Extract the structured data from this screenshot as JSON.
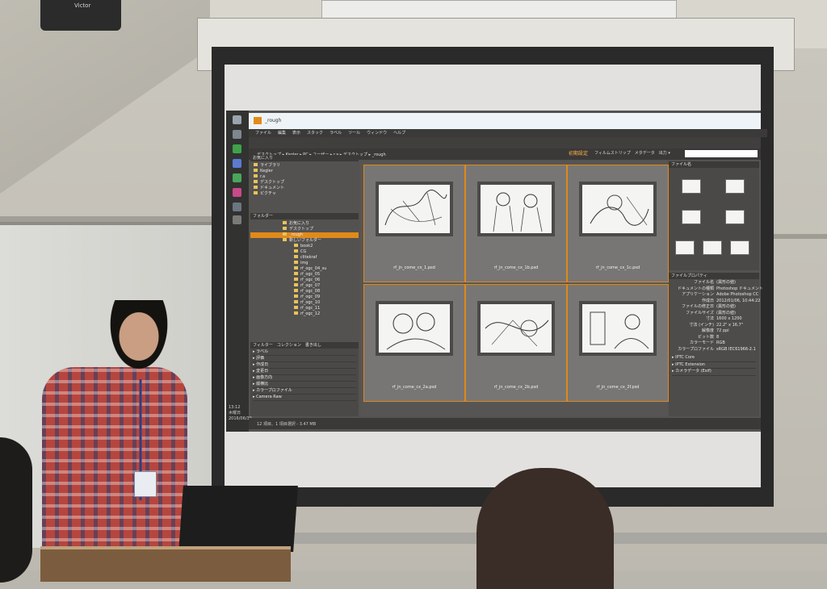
{
  "room": {
    "speaker_brand": "Victor",
    "colors": {
      "wall": "#c9c6bd",
      "shirt": "#b6463d",
      "accent_orange": "#e08a1a"
    }
  },
  "app": {
    "title": "_rough",
    "menu": [
      "ファイル",
      "編集",
      "表示",
      "スタック",
      "ラベル",
      "ツール",
      "ウィンドウ",
      "ヘルプ"
    ],
    "breadcrumb": "デスクトップ ▸ Kegler ▸ PC ▸ ユーザー ▸ r.a ▸ デスクトップ ▸ _rough",
    "workspace_active": "初期設定",
    "workspace_tabs": "フィルムストリップ　メタデータ　出力 ▾",
    "favorites_header": "お気に入り",
    "favorites": [
      "ライブラリ",
      "Kegler",
      "r.a",
      "デスクトップ",
      "ドキュメント",
      "ピクチャ"
    ],
    "folders_header": "フォルダー",
    "folders": [
      {
        "label": "お気に入り",
        "selected": false
      },
      {
        "label": "デスクトップ",
        "selected": false
      },
      {
        "label": "_rough",
        "selected": true
      },
      {
        "label": "新しいフォルダー",
        "selected": false
      },
      {
        "label": "book2",
        "selected": false
      },
      {
        "label": "CG",
        "selected": false
      },
      {
        "label": "clitekraf",
        "selected": false
      },
      {
        "label": "img",
        "selected": false
      },
      {
        "label": "rf_ogc_04_su",
        "selected": false
      },
      {
        "label": "rf_ogc_05",
        "selected": false
      },
      {
        "label": "rf_ogc_06",
        "selected": false
      },
      {
        "label": "rf_ogc_07",
        "selected": false
      },
      {
        "label": "rf_ogc_08",
        "selected": false
      },
      {
        "label": "rf_ogc_09",
        "selected": false
      },
      {
        "label": "rf_ogc_10",
        "selected": false
      },
      {
        "label": "rf_ogc_11",
        "selected": false
      },
      {
        "label": "rf_ogc_12",
        "selected": false
      }
    ],
    "filter_header": "フィルター　コレクション　書き出し",
    "filters": [
      "ラベル",
      "評価",
      "作成日",
      "変更日",
      "画像方向",
      "縦横比",
      "カラープロファイル",
      "Camera Raw"
    ],
    "files": [
      {
        "name": "rf_jn_come_cx_1.psd"
      },
      {
        "name": "rf_jn_come_cx_1b.psd"
      },
      {
        "name": "rf_jn_come_cx_1c.psd"
      },
      {
        "name": "rf_jn_come_cx_2a.psd"
      },
      {
        "name": "rf_jn_come_cx_2b.psd"
      },
      {
        "name": "rf_jn_come_cx_2f.psd"
      }
    ],
    "preview_header": "ファイル名",
    "metadata_header": "ファイルプロパティ",
    "metadata": [
      {
        "k": "ファイル名",
        "v": "(異形の値)"
      },
      {
        "k": "ドキュメントの種類",
        "v": "Photoshop ドキュメント"
      },
      {
        "k": "アプリケーション",
        "v": "Adobe Photoshop CC"
      },
      {
        "k": "作成日",
        "v": "2012/01/06, 10:44:22"
      },
      {
        "k": "ファイルの修正日",
        "v": "(異形の値)"
      },
      {
        "k": "ファイルサイズ",
        "v": "(異形の値)"
      },
      {
        "k": "寸法",
        "v": "1600 x 1200"
      },
      {
        "k": "寸法 (インチ)",
        "v": "22.2\" x 16.7\""
      },
      {
        "k": "解像度",
        "v": "72 ppi"
      },
      {
        "k": "ビット数",
        "v": "8"
      },
      {
        "k": "カラーモード",
        "v": "RGB"
      },
      {
        "k": "カラープロファイル",
        "v": "sRGB IEC61966-2.1"
      }
    ],
    "meta_sections": [
      "IPTC Core",
      "IPTC Extension",
      "カメラデータ (Exif)"
    ],
    "status": "12 項目、1 項目選択 - 3.47 MB",
    "clock": {
      "time": "13:12",
      "day": "木曜日",
      "date": "2016/06/30"
    }
  }
}
